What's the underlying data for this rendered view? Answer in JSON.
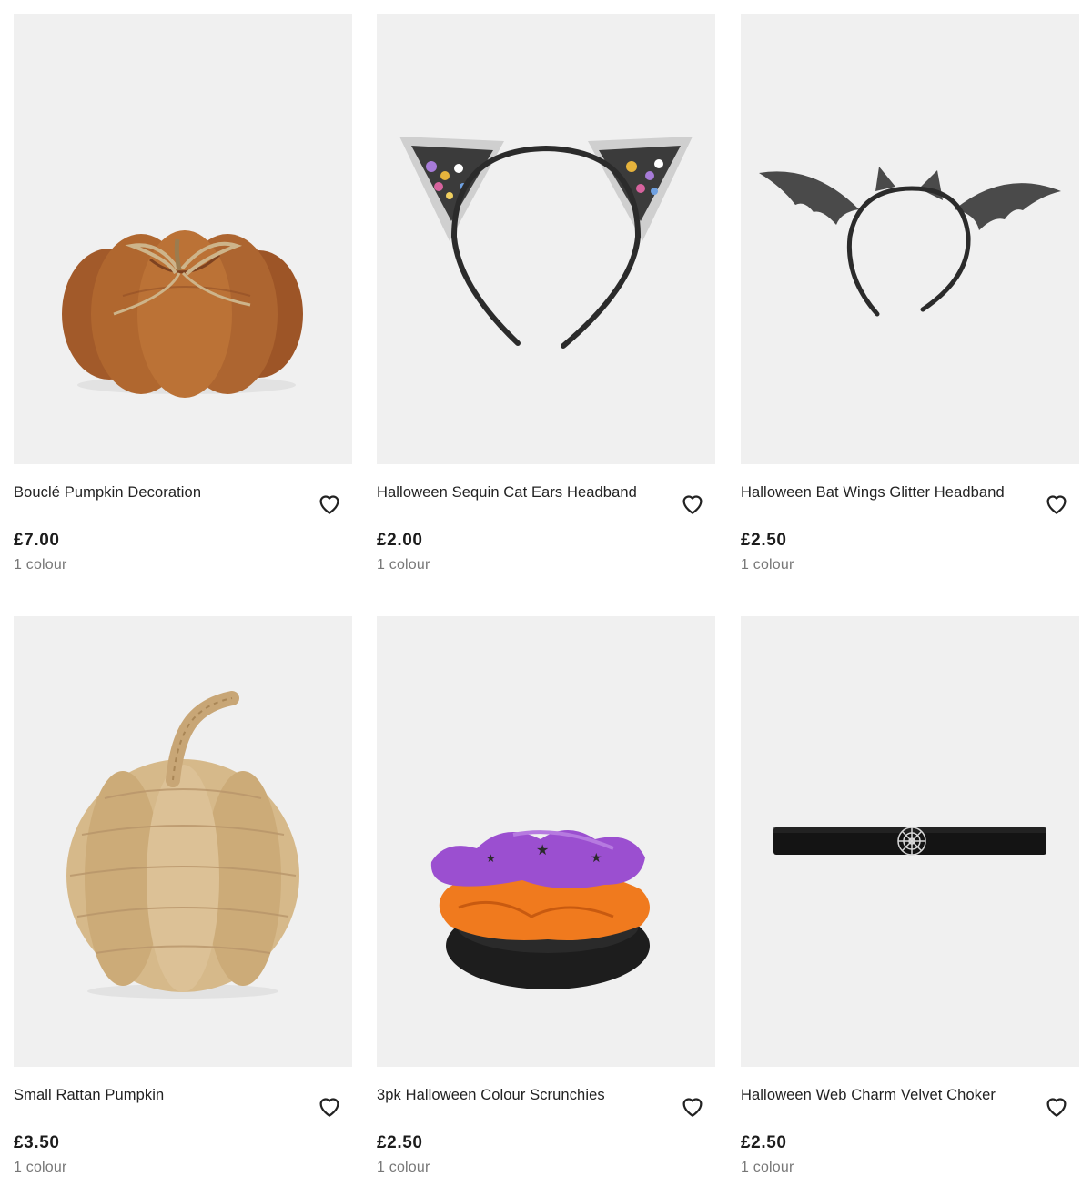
{
  "products": [
    {
      "title": "Bouclé Pumpkin Decoration",
      "price": "£7.00",
      "colours": "1 colour",
      "image_icon": "boucle-pumpkin-image",
      "wishlist_icon": "heart-icon"
    },
    {
      "title": "Halloween Sequin Cat Ears Headband",
      "price": "£2.00",
      "colours": "1 colour",
      "image_icon": "cat-ears-headband-image",
      "wishlist_icon": "heart-icon"
    },
    {
      "title": "Halloween Bat Wings Glitter Headband",
      "price": "£2.50",
      "colours": "1 colour",
      "image_icon": "bat-wings-headband-image",
      "wishlist_icon": "heart-icon"
    },
    {
      "title": "Small Rattan Pumpkin",
      "price": "£3.50",
      "colours": "1 colour",
      "image_icon": "rattan-pumpkin-image",
      "wishlist_icon": "heart-icon"
    },
    {
      "title": "3pk Halloween Colour Scrunchies",
      "price": "£2.50",
      "colours": "1 colour",
      "image_icon": "scrunchies-image",
      "wishlist_icon": "heart-icon"
    },
    {
      "title": "Halloween Web Charm Velvet Choker",
      "price": "£2.50",
      "colours": "1 colour",
      "image_icon": "velvet-choker-image",
      "wishlist_icon": "heart-icon"
    }
  ],
  "colors": {
    "image_bg": "#f0f0f0",
    "title_text": "#222222",
    "price_text": "#1c1c1c",
    "secondary_text": "#777777"
  }
}
